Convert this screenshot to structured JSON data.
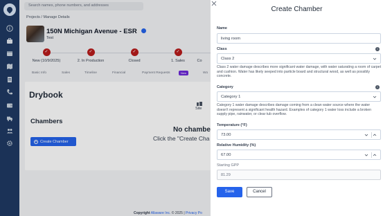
{
  "colors": {
    "rail": "#1f3a63",
    "accent": "#2563eb",
    "step_done": "#b91c1c",
    "new_badge": "#6d28d9"
  },
  "rail_icons": [
    "info-icon",
    "briefcase-icon",
    "calendar-icon",
    "map-icon",
    "document-icon",
    "phone-icon",
    "wallet-icon",
    "truck-icon",
    "users-icon",
    "settings-icon"
  ],
  "search": {
    "placeholder": "Search names, phone numbers, and addresses"
  },
  "breadcrumb": "Projects / Manage Details",
  "project": {
    "title": "150N Michigan Avenue - ESR",
    "subtitle": "Test"
  },
  "steps": [
    {
      "label": "New (10/9/2025)"
    },
    {
      "label": "2. In Production"
    },
    {
      "label": "Closed"
    },
    {
      "label": "1. Sales"
    },
    {
      "label": "Co"
    }
  ],
  "tabs": [
    "Basic Info",
    "Sales",
    "Timeline",
    "Financial",
    "Payment Requests",
    "Wo"
  ],
  "tabs_new_badge": "New",
  "drybook": {
    "title": "Drybook",
    "site_label": "Site",
    "chambers_heading": "Chambers",
    "create_button": "Create Chamber",
    "empty_title": "No chambe",
    "empty_sub": "Click the \"Create Cha"
  },
  "footer": {
    "label": "Copyright",
    "company": "Allaware Inc.",
    "year": "© 2025 |",
    "privacy": "Privacy Po"
  },
  "drawer": {
    "title": "Create Chamber",
    "name_label": "Name",
    "name_value": "living room",
    "class_label": "Class",
    "class_value": "Class 2",
    "class_desc": "Class 2 water damage describes more significant water damage, with water saturating a room of carpet and cushion. Water has likely seeped into particle board and structural wood, as well as possibly concrete.",
    "category_label": "Category",
    "category_value": "Category 1",
    "category_desc": "Category 1 water damage describes damage coming from a clean water source where the water doesn't represent a significant health hazard. Examples of category 1 water loss include a broken supply pipe, rainwater, or clear tub overflow.",
    "temp_label": "Temperature (°F)",
    "temp_value": "73.00",
    "rh_label": "Relative Humidity (%)",
    "rh_value": "67.00",
    "gpp_label": "Starting GPP",
    "gpp_value": "81.29",
    "save": "Save",
    "cancel": "Cancel"
  }
}
